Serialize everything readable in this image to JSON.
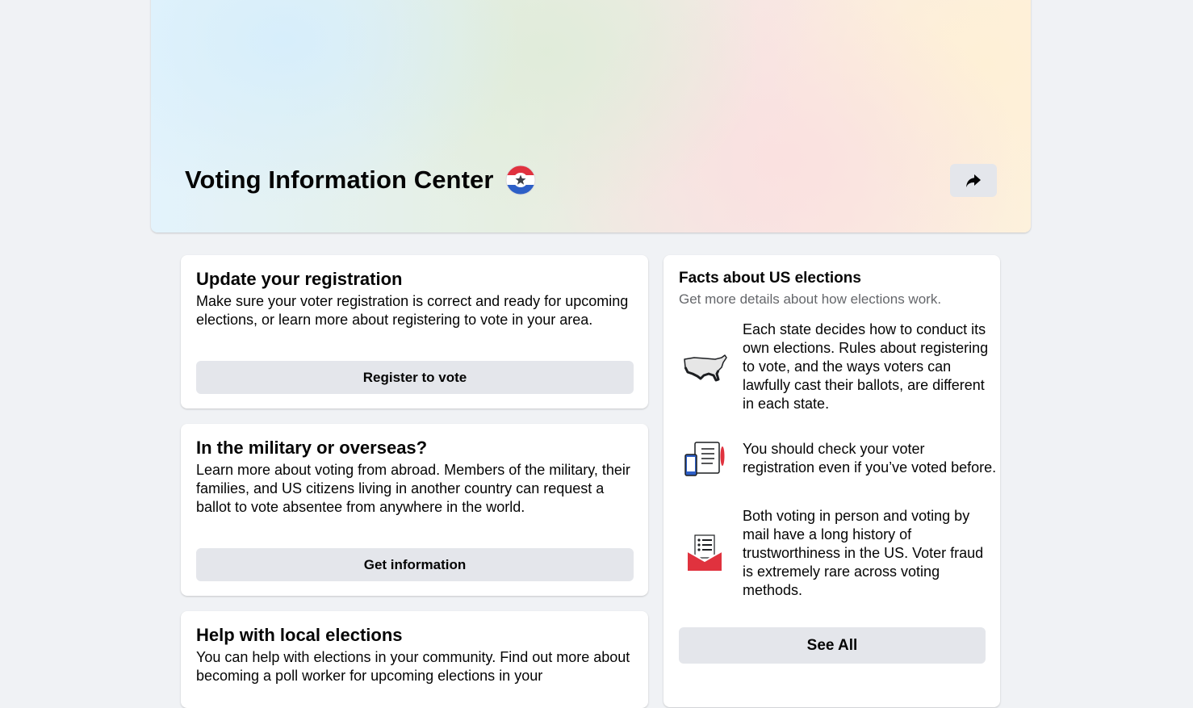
{
  "hero": {
    "title": "Voting Information Center",
    "badge_icon": "voting-badge-icon",
    "share_icon": "share-arrow-icon"
  },
  "cards": [
    {
      "title": "Update your registration",
      "body": "Make sure your voter registration is correct and ready for upcoming elections, or learn more about registering to vote in your area.",
      "button": "Register to vote"
    },
    {
      "title": "In the military or overseas?",
      "body": "Learn more about voting from abroad. Members of the military, their families, and US citizens living in another country can request a ballot to vote absentee from anywhere in the world.",
      "button": "Get information"
    },
    {
      "title": "Help with local elections",
      "body": "You can help with elections in your community. Find out more about becoming a poll worker for upcoming elections in your"
    }
  ],
  "facts": {
    "title": "Facts about US elections",
    "subtitle": "Get more details about how elections work.",
    "items": [
      {
        "icon": "us-map-icon",
        "text": "Each state decides how to conduct its own elections. Rules about registering to vote, and the ways voters can lawfully cast their ballots, are different in each state."
      },
      {
        "icon": "devices-registration-icon",
        "text": "You should check your voter registration even if you’ve voted before."
      },
      {
        "icon": "mail-ballot-icon",
        "text": "Both voting in person and voting by mail have a long history of trustworthiness in the US. Voter fraud is extremely rare across voting methods."
      }
    ],
    "button": "See All"
  },
  "colors": {
    "background": "#f0f2f5",
    "button_bg": "#e4e6eb",
    "text": "#050505",
    "secondary_text": "#65676b",
    "badge_red": "#e0323e",
    "badge_blue": "#2d5fc7"
  }
}
